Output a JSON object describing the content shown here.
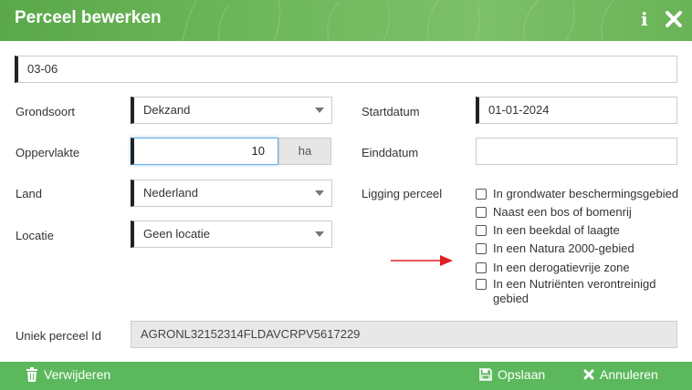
{
  "dialog": {
    "title": "Perceel bewerken"
  },
  "parcel": {
    "name": "03-06"
  },
  "fields": {
    "grondsoort": {
      "label": "Grondsoort",
      "value": "Dekzand"
    },
    "oppervlakte": {
      "label": "Oppervlakte",
      "value": "10",
      "unit": "ha"
    },
    "land": {
      "label": "Land",
      "value": "Nederland"
    },
    "locatie": {
      "label": "Locatie",
      "value": "Geen locatie"
    },
    "startdatum": {
      "label": "Startdatum",
      "value": "01-01-2024"
    },
    "einddatum": {
      "label": "Einddatum",
      "value": ""
    },
    "ligging": {
      "label": "Ligging perceel",
      "options": [
        {
          "label": "In grondwater beschermingsgebied",
          "checked": false
        },
        {
          "label": "Naast een bos of bomenrij",
          "checked": false
        },
        {
          "label": "In een beekdal of laagte",
          "checked": false
        },
        {
          "label": "In een Natura 2000-gebied",
          "checked": false
        },
        {
          "label": "In een derogatievrije zone",
          "checked": false
        },
        {
          "label": "In een Nutriënten verontreinigd gebied",
          "checked": false
        }
      ]
    },
    "uniek_id": {
      "label": "Uniek perceel Id",
      "value": "AGRONL32152314FLDAVCRPV5617229"
    }
  },
  "footer": {
    "delete_label": "Verwijderen",
    "save_label": "Opslaan",
    "cancel_label": "Annuleren"
  },
  "icons": {
    "info": "info-icon",
    "close": "close-icon",
    "trash": "trash-icon",
    "save": "floppy-disk-icon",
    "cancel": "x-icon",
    "annotation": "red-arrow-annotation"
  },
  "colors": {
    "header_green": "#5aa84a",
    "footer_green": "#5cb85c",
    "focus_blue": "#66afe9",
    "annotation_red": "#e02020"
  }
}
